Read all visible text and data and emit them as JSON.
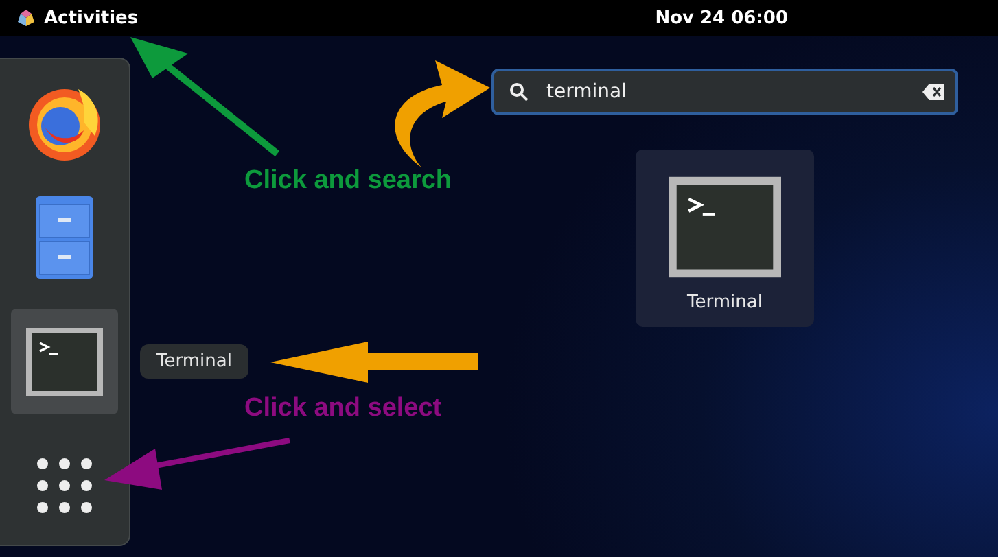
{
  "top_bar": {
    "activities": "Activities",
    "clock": "Nov 24 06:00"
  },
  "dash": {
    "items": [
      {
        "kind": "firefox",
        "selected": false
      },
      {
        "kind": "files",
        "selected": false
      },
      {
        "kind": "terminal",
        "selected": true
      },
      {
        "kind": "app_grid",
        "selected": false
      }
    ],
    "tooltip": "Terminal"
  },
  "search": {
    "value": "terminal"
  },
  "results": [
    {
      "kind": "terminal",
      "label": "Terminal"
    }
  ],
  "annotations": [
    {
      "kind": "search_hint",
      "text": "Click and search",
      "color": "#0d9a3c"
    },
    {
      "kind": "select_hint",
      "text": "Click and select",
      "color": "#8d0b80"
    }
  ]
}
